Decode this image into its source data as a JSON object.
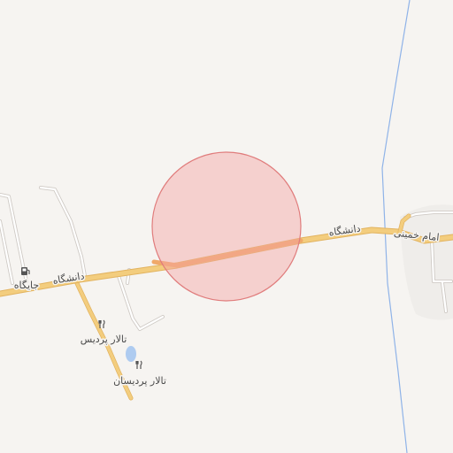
{
  "map": {
    "background": "#f6f4f1",
    "road_color": "#f3cd7e",
    "road_casing": "#e2b35f",
    "minor_road_color": "#ffffff",
    "minor_road_casing": "#cfcac5",
    "water_line_color": "#8fb3e8",
    "highlight": {
      "fill": "#f4a3a3",
      "stroke": "#e07c7c",
      "opacity": 0.45,
      "road_segment_color": "#f0a96a"
    },
    "labels": {
      "main_road_west": "دانشگاه",
      "main_road_east": "دانشگاه",
      "road_right": "امام خمینی",
      "gas_station": "جایگاه",
      "hall_1": "تالار پردیس",
      "hall_2": "تالار پردیسان"
    },
    "icons": {
      "gas_station": "fuel-pump-icon",
      "hall_1": "restaurant-icon",
      "hall_2": "restaurant-icon",
      "water": "pond-icon"
    }
  }
}
